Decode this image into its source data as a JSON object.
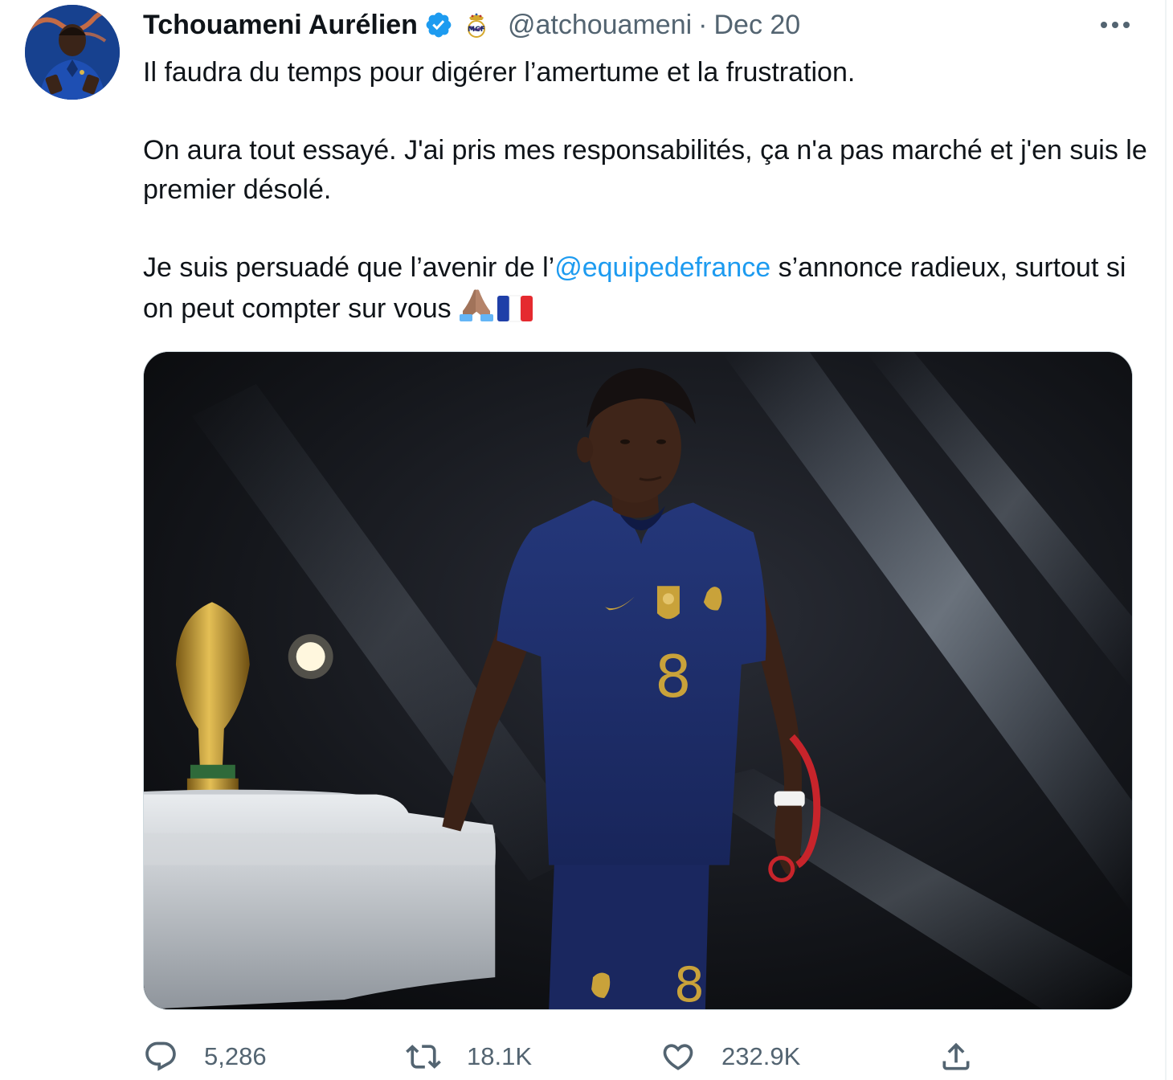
{
  "tweet": {
    "author": {
      "display_name": "Tchouameni Aurélien",
      "handle": "@atchouameni",
      "verified": true,
      "affiliation_icon": "real-madrid-crest-icon"
    },
    "separator": "·",
    "date": "Dec 20",
    "text": {
      "paragraph1": "Il faudra du temps pour digérer l’amertume et la frustration.",
      "paragraph2": "On aura tout essayé. J'ai pris mes responsabilités, ça n'a pas marché et j'en suis le premier désolé.",
      "paragraph3_before": "Je suis persuadé que l’avenir de l’",
      "mention": "@equipedefrance",
      "paragraph3_after": " s’annonce radieux, surtout si on peut compter sur vous",
      "emojis": [
        "folded-hands-medium-dark-skin-emoji",
        "france-flag-emoji"
      ]
    },
    "media": {
      "type": "photo",
      "jersey_number": "8"
    },
    "stats": {
      "replies": "5,286",
      "retweets": "18.1K",
      "likes": "232.9K"
    }
  },
  "colors": {
    "link": "#1d9bf0",
    "secondary_text": "#536471",
    "primary_text": "#0f1419",
    "verified_badge": "#1d9bf0",
    "jersey_navy": "#1c2d6b",
    "gold": "#c9a23a"
  },
  "icons": {
    "verified": "verified-badge-icon",
    "more": "more-horizontal-icon",
    "reply": "reply-icon",
    "retweet": "retweet-icon",
    "like": "heart-icon",
    "share": "share-icon"
  }
}
